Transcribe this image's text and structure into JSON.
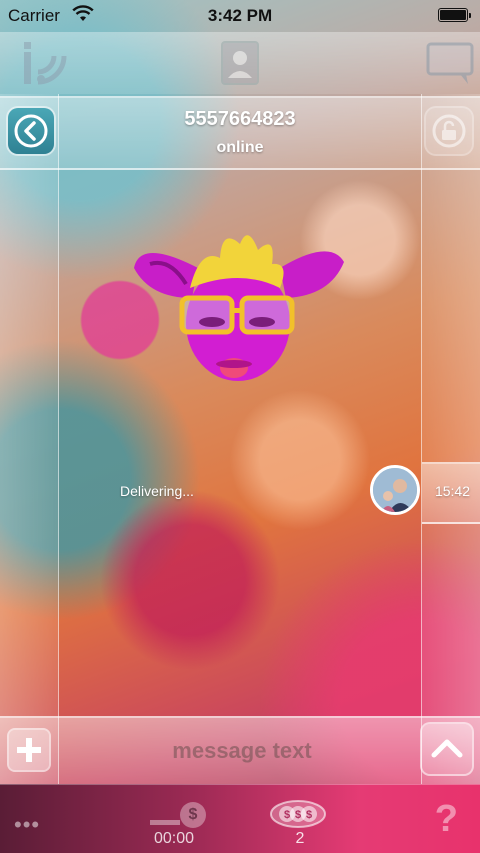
{
  "status_bar": {
    "carrier": "Carrier",
    "time": "3:42 PM"
  },
  "top_bar": {
    "icons": [
      "app-logo-icon",
      "contacts-icon",
      "chat-icon"
    ]
  },
  "chat_header": {
    "number": "5557664823",
    "status": "online",
    "left_button": "back-icon",
    "right_button": "lock-icon"
  },
  "conversation": {
    "sticker": "pink-creature-with-glasses-sticker",
    "message_status": "Delivering...",
    "message_time": "15:42"
  },
  "composer": {
    "placeholder": "message text",
    "left_button": "plus-icon",
    "right_button": "chevron-up-icon"
  },
  "bottom_bar": {
    "timer": "00:00",
    "count": "2",
    "icons": [
      "more-icon",
      "dollar-icon",
      "coins-icon",
      "help-icon"
    ]
  },
  "colors": {
    "accent": "#2f8193",
    "bottom_bar": "#e8326c",
    "status_text": "#ffffff"
  }
}
